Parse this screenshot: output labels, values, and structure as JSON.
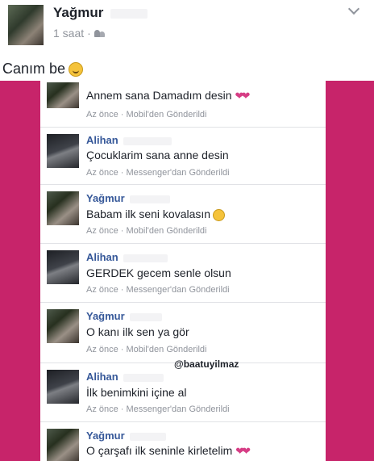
{
  "post": {
    "author": "Yağmur",
    "time": "1 saat",
    "separator": "·",
    "text": "Canım be"
  },
  "comments": [
    {
      "author": "",
      "text": "Annem sana Damadım desin",
      "meta": "Az önce · Mobil'den Gönderildi"
    },
    {
      "author": "Alihan",
      "text": "Çocuklarim sana anne desin",
      "meta": "Az önce · Messenger'dan Gönderildi"
    },
    {
      "author": "Yağmur",
      "text": "Babam ilk seni kovalasın",
      "meta": "Az önce · Mobil'den Gönderildi"
    },
    {
      "author": "Alihan",
      "text": "GERDEK gecem senle olsun",
      "meta": "Az önce · Messenger'dan Gönderildi"
    },
    {
      "author": "Yağmur",
      "text": "O kanı ilk sen ya gör",
      "meta": "Az önce · Mobil'den Gönderildi"
    },
    {
      "author": "Alihan",
      "text": "İlk benimkini içine al",
      "meta": "Az önce · Messenger'dan Gönderildi"
    },
    {
      "author": "Yağmur",
      "text": "O çarşafı ilk seninle kirletelim",
      "meta": ""
    }
  ],
  "watermark": "@baatuyilmaz",
  "colors": {
    "background_pink": "#c7246a",
    "author_blue": "#365899",
    "meta_gray": "#90949c"
  },
  "icons": {
    "audience": "friends-icon",
    "options": "chevron-down-icon",
    "post_emoji": "smile-emoji-icon",
    "hearts": "hearts-emoji-icon",
    "wink": "wink-emoji-icon"
  }
}
